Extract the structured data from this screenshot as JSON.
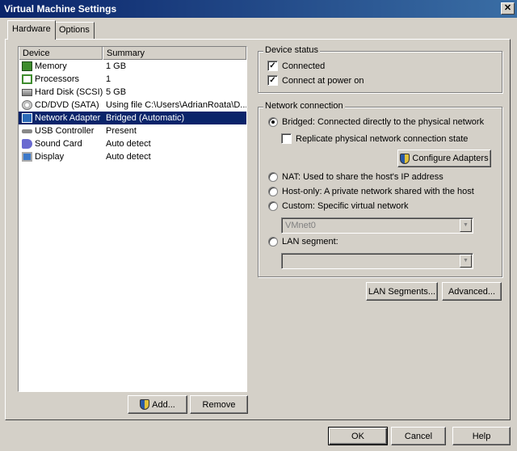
{
  "window": {
    "title": "Virtual Machine Settings"
  },
  "tabs": [
    {
      "label": "Hardware"
    },
    {
      "label": "Options"
    }
  ],
  "device_list": {
    "headers": {
      "device": "Device",
      "summary": "Summary"
    },
    "rows": [
      {
        "device": "Memory",
        "summary": "1 GB",
        "icon": "memory-icon"
      },
      {
        "device": "Processors",
        "summary": "1",
        "icon": "processor-icon"
      },
      {
        "device": "Hard Disk (SCSI)",
        "summary": "5 GB",
        "icon": "hard-disk-icon"
      },
      {
        "device": "CD/DVD (SATA)",
        "summary": "Using file C:\\Users\\AdrianRoata\\D...",
        "icon": "cd-dvd-icon"
      },
      {
        "device": "Network Adapter",
        "summary": "Bridged (Automatic)",
        "icon": "network-adapter-icon",
        "selected": true
      },
      {
        "device": "USB Controller",
        "summary": "Present",
        "icon": "usb-icon"
      },
      {
        "device": "Sound Card",
        "summary": "Auto detect",
        "icon": "sound-card-icon"
      },
      {
        "device": "Display",
        "summary": "Auto detect",
        "icon": "display-icon"
      }
    ],
    "add_label": "Add...",
    "remove_label": "Remove"
  },
  "device_status": {
    "title": "Device status",
    "connected": {
      "label": "Connected",
      "checked": true
    },
    "connect_power_on": {
      "label": "Connect at power on",
      "checked": true
    }
  },
  "network_connection": {
    "title": "Network connection",
    "bridged": {
      "label": "Bridged: Connected directly to the physical network",
      "selected": true
    },
    "replicate": {
      "label": "Replicate physical network connection state",
      "checked": false
    },
    "configure_label": "Configure Adapters",
    "nat": {
      "label": "NAT: Used to share the host's IP address"
    },
    "host_only": {
      "label": "Host-only: A private network shared with the host"
    },
    "custom": {
      "label": "Custom: Specific virtual network"
    },
    "custom_value": "VMnet0",
    "lan_segment": {
      "label": "LAN segment:"
    },
    "lan_value": ""
  },
  "buttons": {
    "lan_segments": "LAN Segments...",
    "advanced": "Advanced...",
    "ok": "OK",
    "cancel": "Cancel",
    "help": "Help"
  }
}
